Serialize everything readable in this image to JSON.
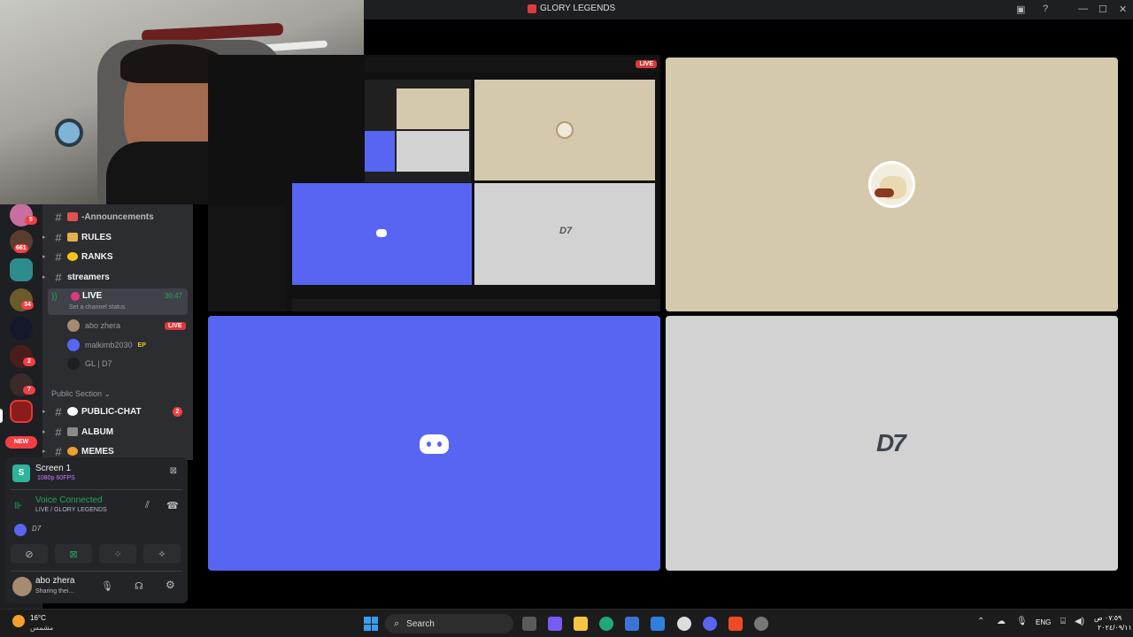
{
  "window": {
    "title": "GLORY LEGENDS",
    "controls": [
      "minimize",
      "maximize",
      "close"
    ]
  },
  "server_rail": {
    "badges": [
      "5",
      "661",
      "34",
      "2",
      "7"
    ],
    "new_label": "NEW"
  },
  "channels": {
    "items": [
      {
        "name": "-Announcements",
        "emoji": "megaphone"
      },
      {
        "name": "RULES",
        "emoji": "scroll"
      },
      {
        "name": "RANKS",
        "emoji": "star"
      },
      {
        "name": "streamers",
        "emoji": ""
      }
    ],
    "voice": {
      "name": "LIVE",
      "time": "30:47",
      "status_placeholder": "Set a channel status",
      "members": [
        {
          "name": "abo zhera",
          "tag": "LIVE"
        },
        {
          "name": "malkimb2030",
          "tag": "EP"
        },
        {
          "name": "GL | D7",
          "tag": ""
        }
      ]
    },
    "section": "Public Section",
    "public": [
      {
        "name": "PUBLIC-CHAT",
        "count": "2"
      },
      {
        "name": "ALBUM",
        "count": ""
      },
      {
        "name": "MEMES",
        "count": ""
      }
    ]
  },
  "panel": {
    "screen_title": "Screen 1",
    "screen_quality": "1080p 60FPS",
    "voice_status": "Voice Connected",
    "voice_channel": "LIVE / GLORY LEGENDS",
    "user_name": "abo zhera",
    "user_status": "Sharing thei..."
  },
  "nested_live_label": "LIVE",
  "taskbar": {
    "weather_temp": "16°C",
    "weather_text": "مشمس",
    "search_label": "Search",
    "lang": "ENG",
    "time": "٠٧:٥٩ ص",
    "date": "٢٠٢٤/٠٩/١١"
  },
  "colors": {
    "discord_blurple": "#5865f2",
    "tile_beige": "#d5c9ad",
    "tile_grey": "#d2d2d2",
    "live_red": "#da373c",
    "voice_green": "#23a55a"
  }
}
